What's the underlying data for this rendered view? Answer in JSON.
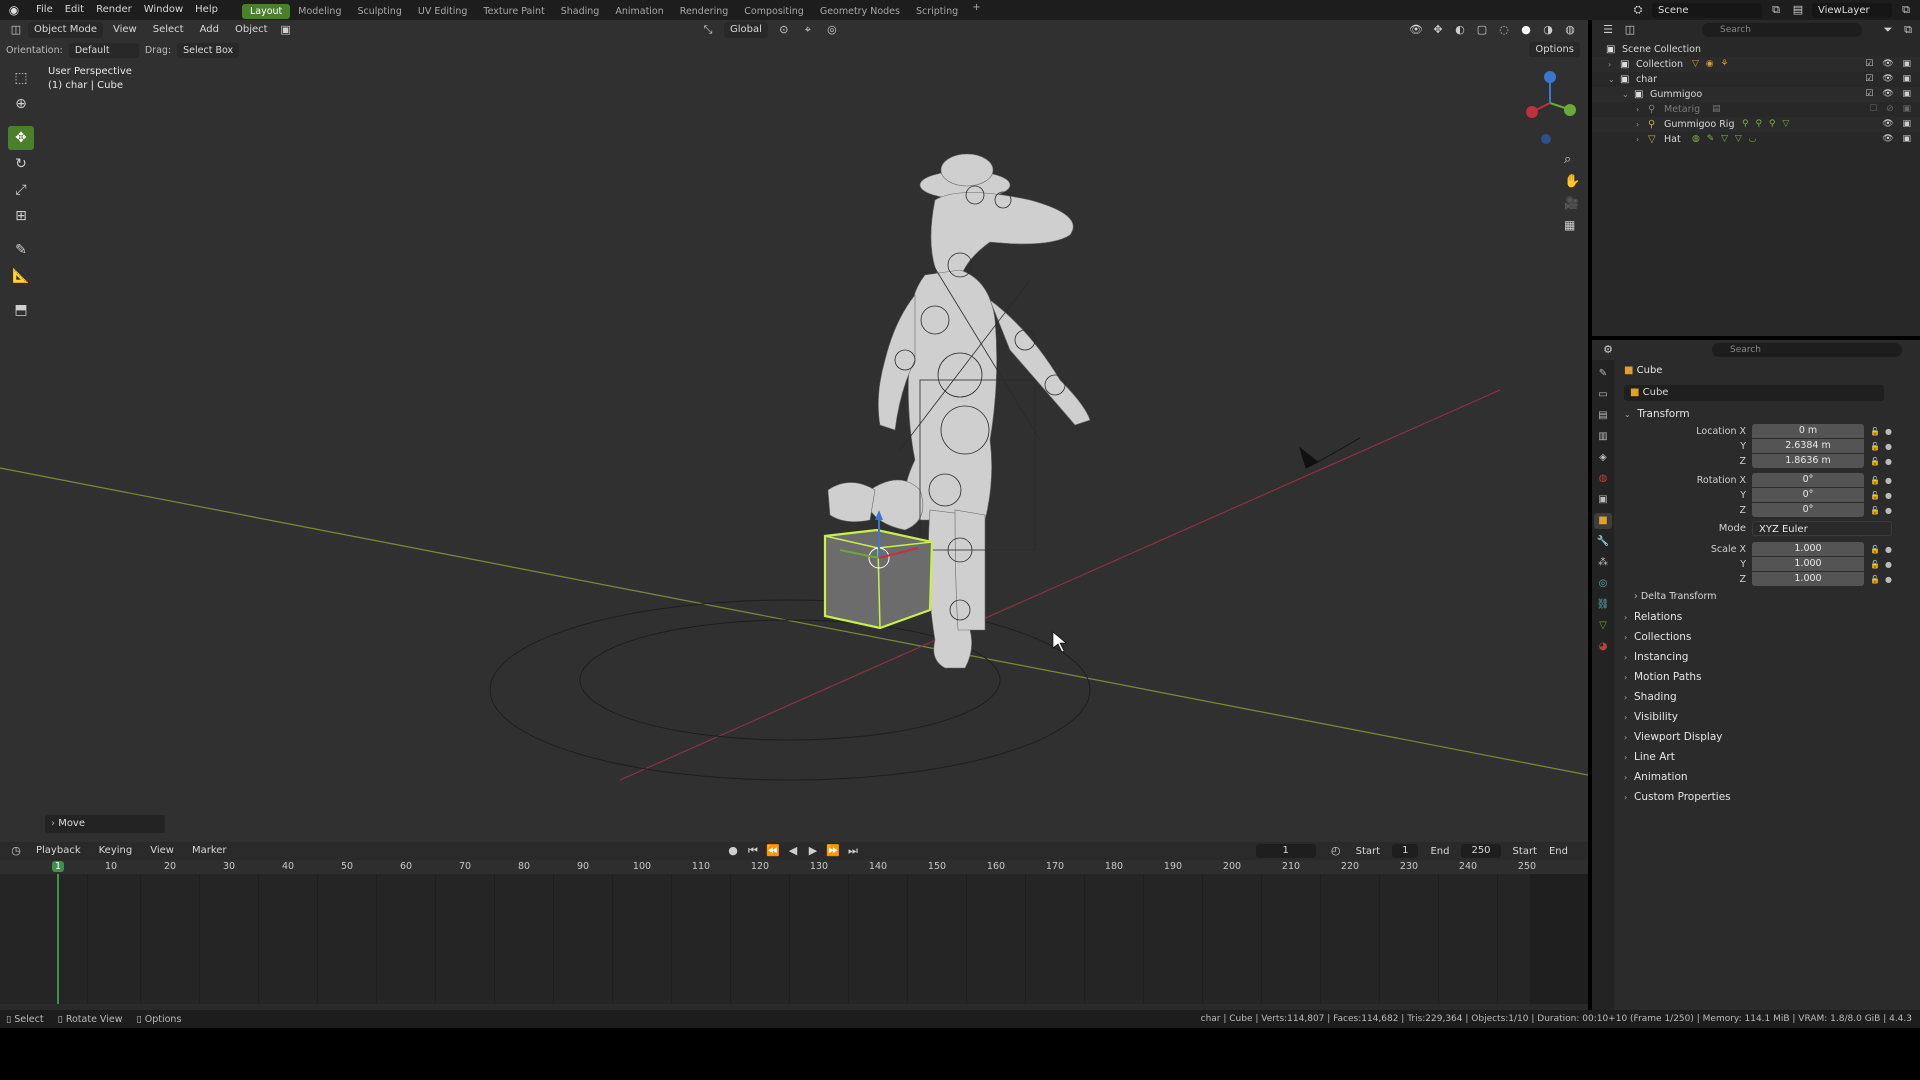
{
  "menu": [
    "File",
    "Edit",
    "Render",
    "Window",
    "Help"
  ],
  "workspaces": [
    "Layout",
    "Modeling",
    "Sculpting",
    "UV Editing",
    "Texture Paint",
    "Shading",
    "Animation",
    "Rendering",
    "Compositing",
    "Geometry Nodes",
    "Scripting"
  ],
  "active_workspace": "Layout",
  "scene_name": "Scene",
  "view_layer": "ViewLayer",
  "viewport": {
    "mode": "Object Mode",
    "menus": [
      "View",
      "Select",
      "Add",
      "Object"
    ],
    "orientation_label": "Orientation:",
    "orientation_value": "Default",
    "drag_label": "Drag:",
    "drag_value": "Select Box",
    "transform_orientation": "Global",
    "options": "Options",
    "perspective": "User Perspective",
    "context": "(1) char | Cube",
    "last_op": "Move"
  },
  "timeline": {
    "menus": [
      "Playback",
      "Keying",
      "View",
      "Marker"
    ],
    "current_frame": "1",
    "start_label": "Start",
    "start": "1",
    "end_label": "End",
    "end": "250",
    "ticks": [
      "1",
      "10",
      "20",
      "30",
      "40",
      "50",
      "60",
      "70",
      "80",
      "90",
      "100",
      "110",
      "120",
      "130",
      "140",
      "150",
      "160",
      "170",
      "180",
      "190",
      "200",
      "210",
      "220",
      "230",
      "240",
      "250"
    ]
  },
  "status": {
    "select": "Select",
    "rotate": "Rotate View",
    "options": "Options",
    "stats": "char | Cube | Verts:114,807 | Faces:114,682 | Tris:229,364 | Objects:1/10 | Duration: 00:10+10 (Frame 1/250) | Memory: 114.1 MiB | VRAM: 1.8/8.0 GiB | 4.4.3"
  },
  "outliner": {
    "search_placeholder": "Search",
    "rows": [
      "Scene Collection",
      "Collection",
      "char",
      "Gummigoo",
      "Metarig",
      "Gummigoo Rig",
      "Hat"
    ]
  },
  "properties": {
    "search_placeholder": "Search",
    "object_name": "Cube",
    "datablock": "Cube",
    "transform_label": "Transform",
    "location_label": "Location X",
    "rotation_label": "Rotation X",
    "scale_label": "Scale X",
    "y_label": "Y",
    "z_label": "Z",
    "location": [
      "0 m",
      "2.6384 m",
      "1.8636 m"
    ],
    "rotation": [
      "0°",
      "0°",
      "0°"
    ],
    "mode_label": "Mode",
    "mode_value": "XYZ Euler",
    "scale": [
      "1.000",
      "1.000",
      "1.000"
    ],
    "delta": "Delta Transform",
    "panels": [
      "Relations",
      "Collections",
      "Instancing",
      "Motion Paths",
      "Shading",
      "Visibility",
      "Viewport Display",
      "Line Art",
      "Animation",
      "Custom Properties"
    ]
  }
}
